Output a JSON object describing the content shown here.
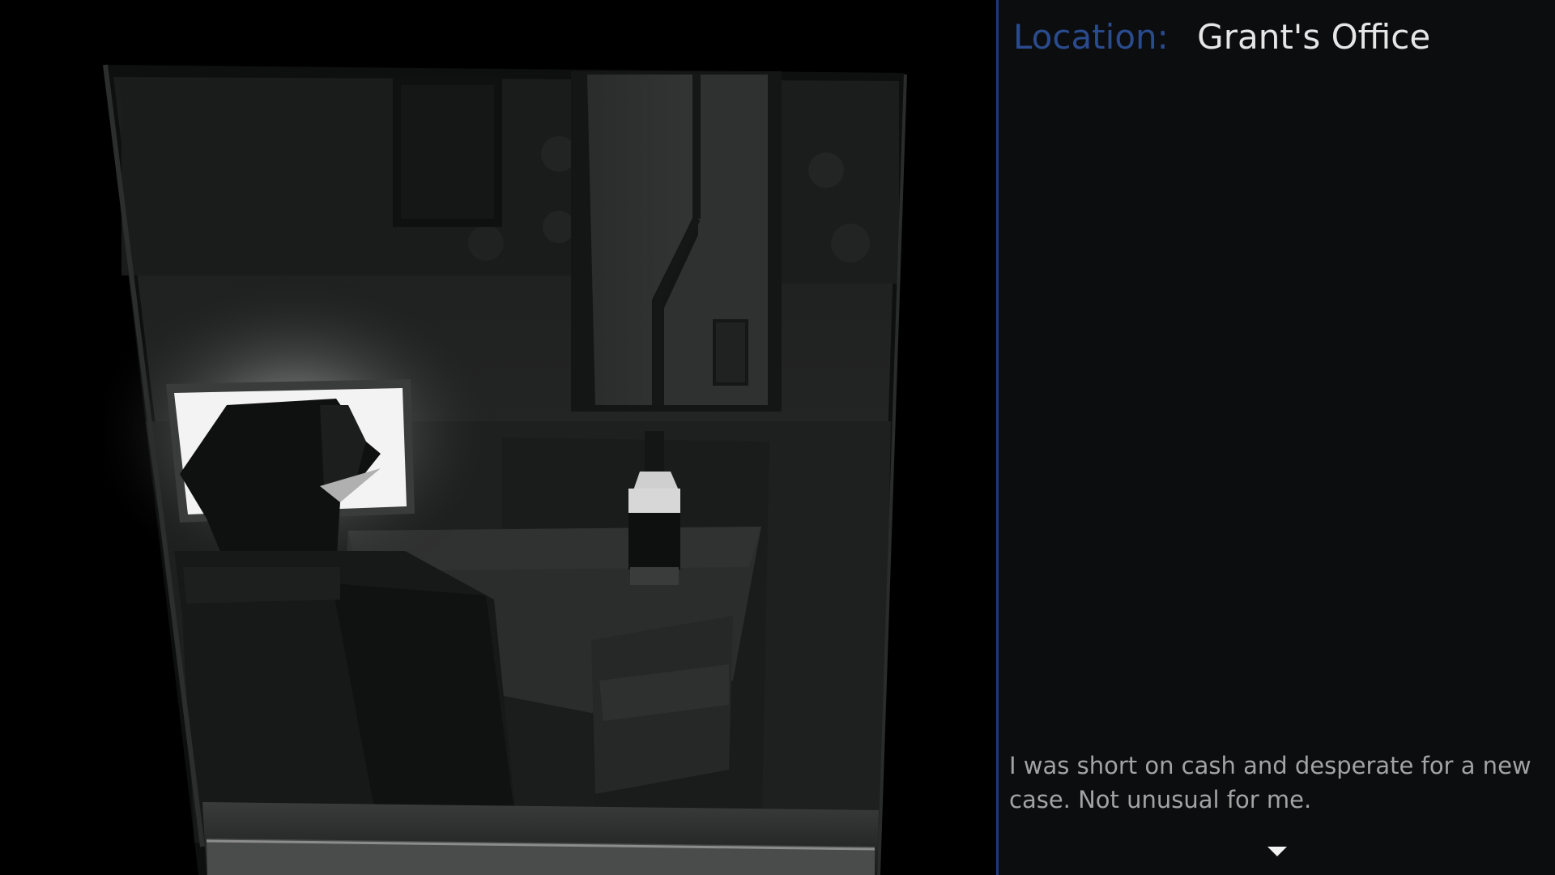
{
  "scene": {
    "description_icon": "office-scene",
    "elements": [
      "window-frame",
      "detective-silhouette",
      "computer-monitor",
      "whiskey-bottle",
      "desk",
      "wardrobe",
      "wall-picture"
    ]
  },
  "location": {
    "label": "Location:",
    "value": "Grant's Office"
  },
  "narration": {
    "text": "I was short on cash and desperate for a new case. Not unusual for me."
  },
  "advance": {
    "icon": "chevron-down-icon"
  },
  "colors": {
    "accent": "#2a4b8d",
    "divider": "#1e3a78",
    "panel_bg": "#0c0d0f",
    "location_value": "#e6e6e6",
    "narration_text": "#a3a3a3"
  }
}
